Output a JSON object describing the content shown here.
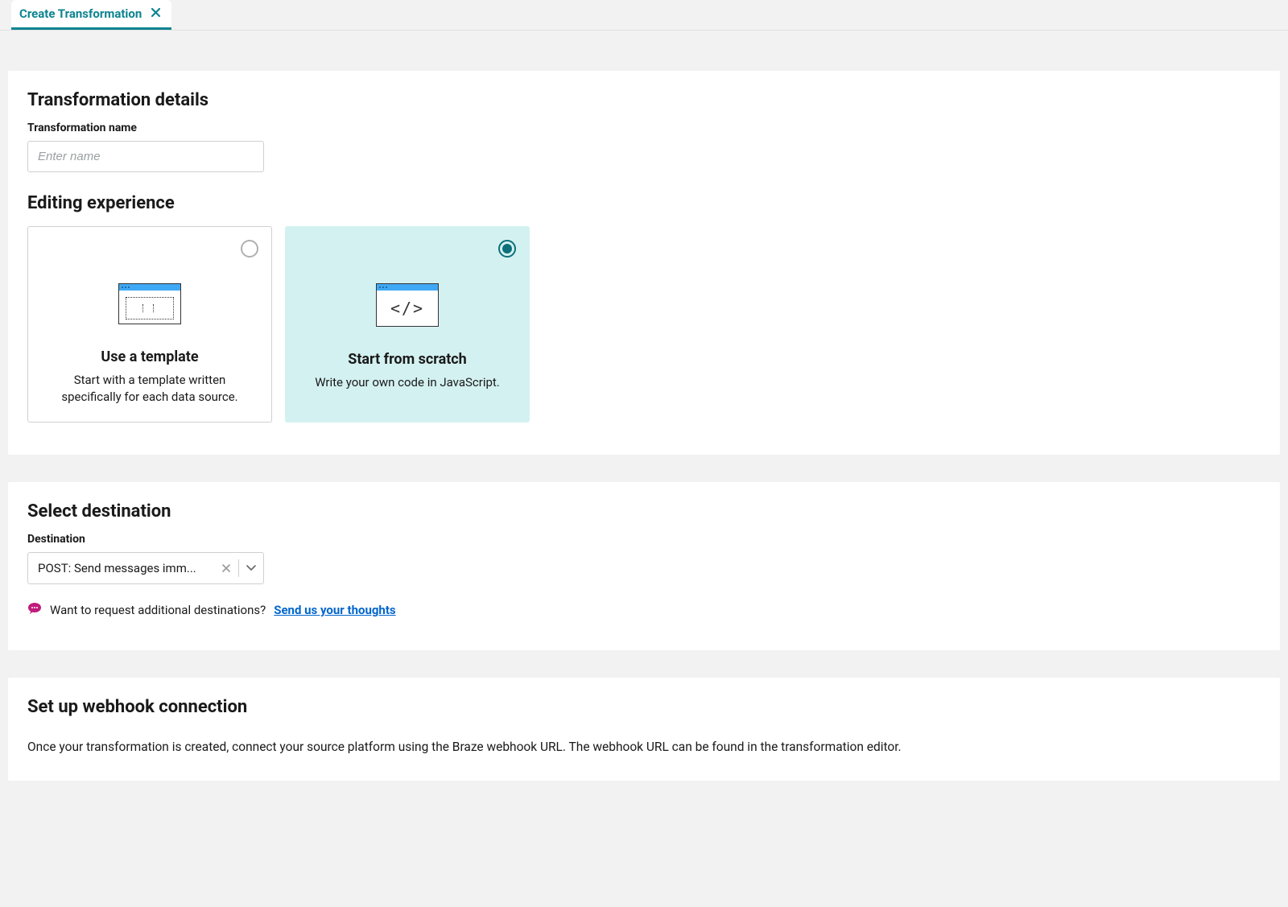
{
  "tab": {
    "label": "Create Transformation"
  },
  "details": {
    "section_title": "Transformation details",
    "name_label": "Transformation name",
    "name_placeholder": "Enter name",
    "name_value": ""
  },
  "editing": {
    "section_title": "Editing experience",
    "options": [
      {
        "title": "Use a template",
        "desc": "Start with a template written specifically for each data source.",
        "selected": false
      },
      {
        "title": "Start from scratch",
        "desc": "Write your own code in JavaScript.",
        "selected": true
      }
    ]
  },
  "destination": {
    "section_title": "Select destination",
    "label": "Destination",
    "selected_value": "POST: Send messages imm...",
    "feedback_text": "Want to request additional destinations?",
    "feedback_link": "Send us your thoughts"
  },
  "webhook": {
    "section_title": "Set up webhook connection",
    "body": "Once your transformation is created, connect your source platform using the Braze webhook URL. The webhook URL can be found in the transformation editor."
  }
}
